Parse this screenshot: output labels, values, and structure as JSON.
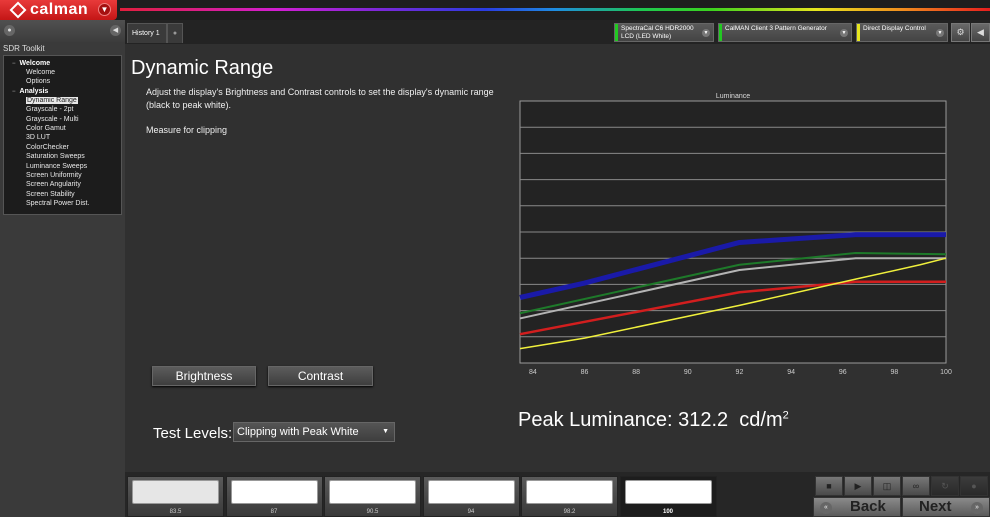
{
  "app": {
    "name": "calman",
    "menu_icon": "chevron-down-icon"
  },
  "sidebar": {
    "title": "SDR Toolkit",
    "groups": [
      {
        "label": "Welcome",
        "items": [
          {
            "label": "Welcome"
          },
          {
            "label": "Options"
          }
        ]
      },
      {
        "label": "Analysis",
        "items": [
          {
            "label": "Dynamic Range",
            "selected": true
          },
          {
            "label": "Grayscale - 2pt"
          },
          {
            "label": "Grayscale - Multi"
          },
          {
            "label": "Color Gamut"
          },
          {
            "label": "3D LUT"
          },
          {
            "label": "ColorChecker"
          },
          {
            "label": "Saturation Sweeps"
          },
          {
            "label": "Luminance Sweeps"
          },
          {
            "label": "Screen Uniformity"
          },
          {
            "label": "Screen Angularity"
          },
          {
            "label": "Screen Stability"
          },
          {
            "label": "Spectral Power Dist."
          }
        ]
      }
    ]
  },
  "tabs": [
    {
      "label": "History 1"
    }
  ],
  "devices": [
    {
      "line1": "SpectraCal C6 HDR2000",
      "line2": "LCD (LED White)",
      "status_color": "#22c822"
    },
    {
      "line1": "CalMAN Client 3 Pattern Generator",
      "line2": "",
      "status_color": "#22c822"
    },
    {
      "line1": "Direct Display Control",
      "line2": "",
      "status_color": "#e6e61e"
    }
  ],
  "main": {
    "title": "Dynamic Range",
    "description": "Adjust the display's Brightness and Contrast controls to set the display's dynamic range (black to peak white).",
    "instruction": "Measure for clipping",
    "brightness_label": "Brightness",
    "contrast_label": "Contrast",
    "test_levels_label": "Test Levels:",
    "test_levels_value": "Clipping with Peak White",
    "peak_label": "Peak Luminance:",
    "peak_value": "312.2",
    "peak_unit": "cd/m",
    "peak_unit_sup": "2"
  },
  "chart_data": {
    "type": "line",
    "title": "Luminance",
    "xlabel": "",
    "ylabel": "",
    "xlim": [
      83.5,
      100
    ],
    "ylim": [
      0,
      10
    ],
    "x_ticks": [
      84,
      86,
      88,
      90,
      92,
      94,
      96,
      98,
      100
    ],
    "y_ticks_unlabeled": 10,
    "grid": true,
    "series": [
      {
        "name": "Blue",
        "color": "#1a1aa8",
        "width": 5,
        "x": [
          83.5,
          86,
          92,
          96.5,
          100
        ],
        "y": [
          2.5,
          3.05,
          4.6,
          4.9,
          4.9
        ]
      },
      {
        "name": "Green",
        "color": "#1e7a2a",
        "width": 2,
        "x": [
          83.5,
          92,
          96.5,
          100
        ],
        "y": [
          1.9,
          3.75,
          4.2,
          4.15
        ]
      },
      {
        "name": "White",
        "color": "#b4b4b4",
        "width": 2,
        "x": [
          83.5,
          92,
          96.5,
          100
        ],
        "y": [
          1.7,
          3.55,
          4.0,
          4.0
        ]
      },
      {
        "name": "Red",
        "color": "#d21e1e",
        "width": 2.5,
        "x": [
          83.5,
          92,
          96.5,
          100
        ],
        "y": [
          1.1,
          2.7,
          3.1,
          3.1
        ]
      },
      {
        "name": "Yellow",
        "color": "#f0f03c",
        "width": 1.5,
        "x": [
          83.5,
          86,
          92,
          96.5,
          99,
          100
        ],
        "y": [
          0.55,
          0.95,
          2.2,
          3.2,
          3.75,
          4.0
        ]
      }
    ]
  },
  "swatches": [
    {
      "label": "83.5",
      "color": "#e6e6e6"
    },
    {
      "label": "87",
      "color": "#ffffff"
    },
    {
      "label": "90.5",
      "color": "#ffffff"
    },
    {
      "label": "94",
      "color": "#ffffff"
    },
    {
      "label": "98.2",
      "color": "#ffffff"
    },
    {
      "label": "100",
      "color": "#ffffff",
      "active": true
    }
  ],
  "controls": {
    "back_label": "Back",
    "next_label": "Next",
    "icons": [
      "stop-icon",
      "play-icon",
      "save-icon",
      "read-continuous-icon",
      "sync-icon",
      "options-icon"
    ]
  }
}
